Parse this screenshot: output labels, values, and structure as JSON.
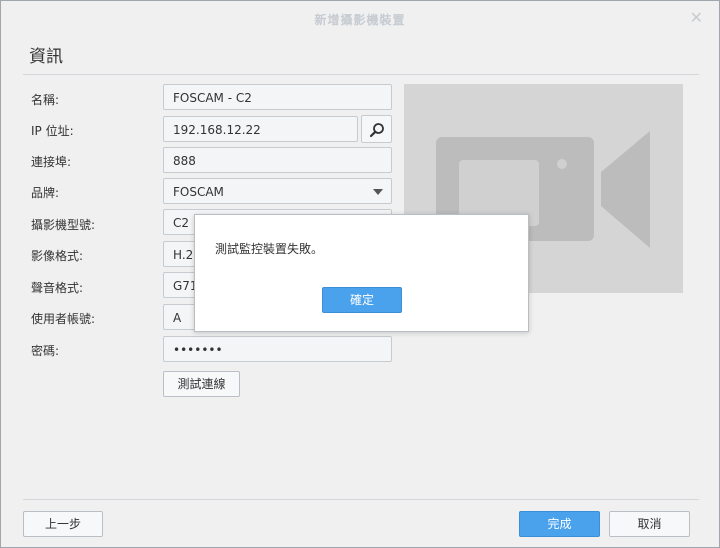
{
  "window": {
    "title": "新增攝影機裝置",
    "close_glyph": "✕"
  },
  "section": {
    "title": "資訊"
  },
  "form": {
    "name": {
      "label": "名稱:",
      "value": "FOSCAM - C2"
    },
    "ip": {
      "label": "IP 位址:",
      "value": "192.168.12.22"
    },
    "port": {
      "label": "連接埠:",
      "value": "888"
    },
    "brand": {
      "label": "品牌:",
      "value": "FOSCAM"
    },
    "model": {
      "label": "攝影機型號:",
      "value": "C2"
    },
    "video": {
      "label": "影像格式:",
      "value": "H.2"
    },
    "audio": {
      "label": "聲音格式:",
      "value": "G71"
    },
    "username": {
      "label": "使用者帳號:",
      "value": "A"
    },
    "password": {
      "label": "密碼:",
      "value": "•••••••"
    },
    "test_button": "測試連線"
  },
  "icons": {
    "search": "search-icon",
    "brand_dropdown": "chevron-down-icon",
    "preview": "video-camera-icon"
  },
  "dialog": {
    "message": "測試監控裝置失敗。",
    "ok_label": "確定"
  },
  "footer": {
    "back_label": "上一步",
    "finish_label": "完成",
    "cancel_label": "取消"
  },
  "colors": {
    "primary": "#4ba2ec",
    "preview_bg": "#d5d5d5",
    "preview_icon": "#bcbcbc"
  }
}
